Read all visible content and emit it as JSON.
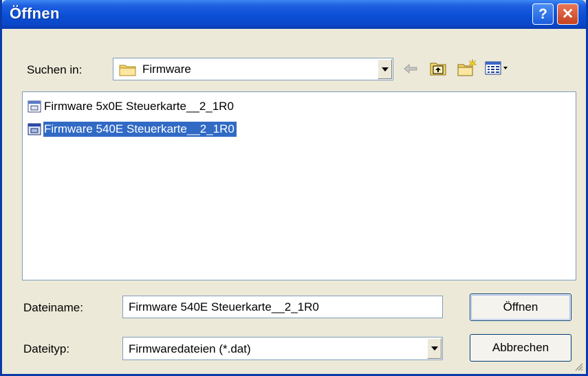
{
  "window": {
    "title": "Öffnen"
  },
  "titlebar_buttons": {
    "help": "?",
    "close": "✕"
  },
  "lookin": {
    "label": "Suchen in:",
    "value": "Firmware"
  },
  "toolbar": {
    "icons": [
      "back-arrow-icon",
      "up-folder-icon",
      "new-folder-icon",
      "view-menu-icon"
    ]
  },
  "files": [
    {
      "name": "Firmware 5x0E Steuerkarte__2_1R0",
      "selected": false
    },
    {
      "name": "Firmware 540E Steuerkarte__2_1R0",
      "selected": true
    }
  ],
  "filename": {
    "label": "Dateiname:",
    "value": "Firmware 540E Steuerkarte__2_1R0"
  },
  "filetype": {
    "label": "Dateityp:",
    "value": "Firmwaredateien (*.dat)"
  },
  "buttons": {
    "open": "Öffnen",
    "cancel": "Abbrechen"
  },
  "colors": {
    "selection": "#316ac5",
    "titlebar": "#0a4fd6",
    "face": "#ece9d8"
  }
}
